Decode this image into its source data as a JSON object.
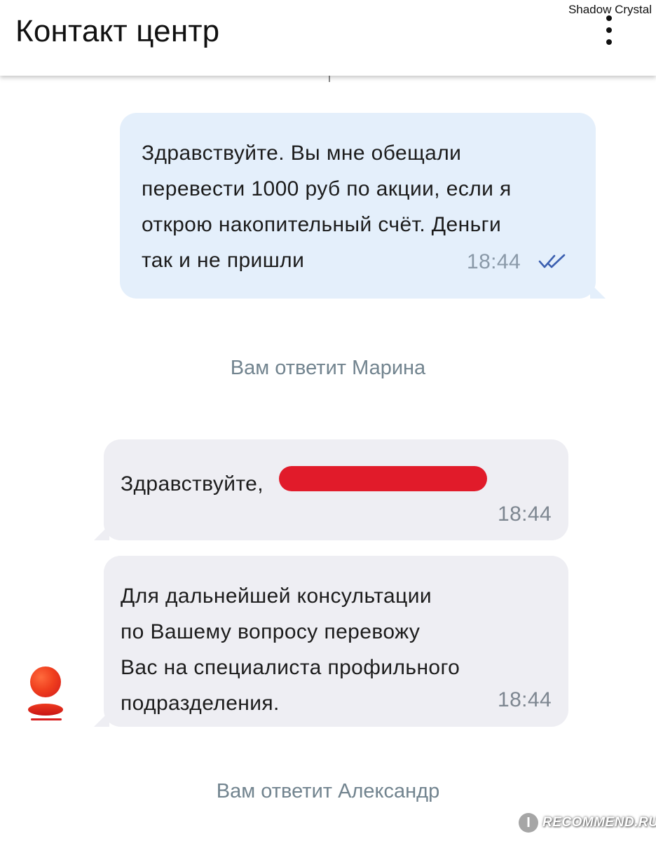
{
  "header": {
    "title": "Контакт центр",
    "user_tag": "Shadow Crystal",
    "menu_icon": "more-vertical-icon"
  },
  "messages": [
    {
      "direction": "outgoing",
      "lines": [
        "Здравствуйте. Вы мне обещали",
        "перевести 1000 руб по акции, если я",
        "открою накопительный счёт. Деньги",
        "так и не пришли"
      ],
      "time": "18:44",
      "status_icon": "double-check-icon"
    },
    {
      "direction": "system",
      "text": "Вам ответит Марина"
    },
    {
      "direction": "incoming",
      "text": "Здравствуйте,",
      "redacted": true,
      "time": "18:44"
    },
    {
      "direction": "incoming",
      "lines": [
        "Для дальнейшей консультации",
        "по Вашему вопросу перевожу",
        "Вас на специалиста профильного",
        "подразделения."
      ],
      "time": "18:44",
      "avatar_icon": "bank-logo-icon"
    },
    {
      "direction": "system",
      "text": "Вам ответит Александр"
    }
  ],
  "watermark": {
    "badge": "I",
    "text": "RECOMMEND.RU"
  },
  "colors": {
    "outgoing_bubble": "#e4effb",
    "incoming_bubble": "#eeeef3",
    "system_text": "#72848f",
    "check_mark": "#3b5fb0",
    "redaction": "#e11b2a"
  }
}
